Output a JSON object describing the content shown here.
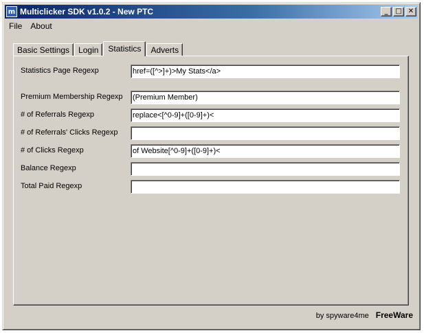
{
  "window": {
    "title": "Multiclicker SDK v1.0.2 - New PTC",
    "icon_glyph": "m",
    "minimize": "_",
    "maximize": "□",
    "close": "✕"
  },
  "menu": [
    "File",
    "About"
  ],
  "tabs": [
    {
      "label": "Basic Settings",
      "active": false
    },
    {
      "label": "Login",
      "active": false
    },
    {
      "label": "Statistics",
      "active": true
    },
    {
      "label": "Adverts",
      "active": false
    }
  ],
  "fields": [
    {
      "label": "Statistics Page Regexp",
      "value": "href=([^>]+)>My Stats</a>"
    },
    {
      "label": "Premium Membership Regexp",
      "value": "(Premium Member)"
    },
    {
      "label": "# of Referrals Regexp",
      "value": "replace<[^0-9]+([0-9]+)<"
    },
    {
      "label": "# of Referrals' Clicks Regexp",
      "value": ""
    },
    {
      "label": "# of Clicks Regexp",
      "value": "of Website[^0-9]+([0-9]+)<"
    },
    {
      "label": "Balance Regexp",
      "value": ""
    },
    {
      "label": "Total Paid Regexp",
      "value": ""
    }
  ],
  "footer": {
    "credit": "by spyware4me",
    "license": "FreeWare"
  }
}
